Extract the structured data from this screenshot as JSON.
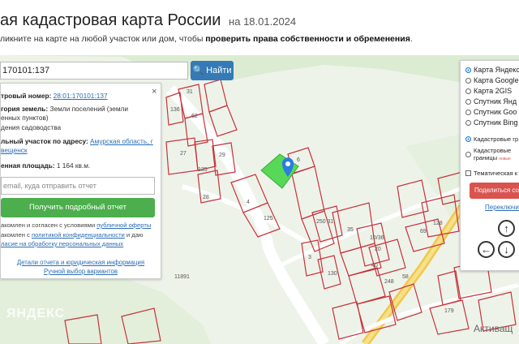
{
  "header": {
    "title": "ая кадастровая карта России",
    "date": "на 18.01.2024",
    "subtitle_pre": "ликните на карте на любой участок или дом, чтобы ",
    "subtitle_bold": "проверить права собственности и обременения",
    "subtitle_post": "."
  },
  "search": {
    "value": "170101:137",
    "button_label": "Найти"
  },
  "card": {
    "close": "×",
    "cadnum_label": "тровый номер:",
    "cadnum_value": "28:01:170101:137",
    "category_label": "гория земель:",
    "category_value_1": "Земли поселений (земли",
    "category_value_2": "енных пунктов)",
    "usage_value": "дения садоводства",
    "address_label": "льный участок по адресу:",
    "address_value_1": "Амурская область, г",
    "address_value_2": "вещенск",
    "area_label": "енная площадь:",
    "area_value": "1 164 кв.м.",
    "email_placeholder": "email, куда отправить отчет",
    "order_button": "Получить подробный отчет",
    "agree1_pre": "акомлен и согласен с условиями ",
    "agree1_link": "публичной оферты",
    "agree2_pre": "акомлен с ",
    "agree2_link": "политикой конфиденциальности",
    "agree2_post": " и даю",
    "agree3_link": "ласие на обработку персональных данных",
    "link_details": "Детали отчета и юридическая информация",
    "link_manual": "Ручной выбор вариантов"
  },
  "layers": {
    "options": [
      {
        "label": "Карта Яндекс",
        "checked": true
      },
      {
        "label": "Карта Google",
        "checked": false
      },
      {
        "label": "Карта 2GIS",
        "checked": false
      },
      {
        "label": "Спутник Янд",
        "checked": false
      },
      {
        "label": "Спутник Goo",
        "checked": false
      },
      {
        "label": "Спутник Bing",
        "checked": false
      }
    ],
    "cad_option_1": "Кадастровые гр",
    "cad_option_2_l1": "Кадастровые",
    "cad_option_2_l2": "границы",
    "cad_option_2_new": "новые",
    "thematic": "Тематическая к",
    "share_button": "Поделиться со",
    "switch_link": "Переключить ка"
  },
  "map": {
    "numbers": [
      "31",
      "136",
      "62",
      "27",
      "135",
      "29",
      "28",
      "4",
      "125",
      "6",
      "3",
      "130",
      "250 31",
      "35",
      "10/36",
      "20",
      "40",
      "248",
      "128",
      "69",
      "58",
      "179",
      "11891"
    ],
    "place_label": "Активащ",
    "watermark": "ЯНДЕКС"
  },
  "colors": {
    "accent": "#337ab7",
    "order": "#4cae4c",
    "share": "#d9534f",
    "parcel": "#c8323c",
    "selected": "#57d957",
    "road": "#f1c84b"
  }
}
